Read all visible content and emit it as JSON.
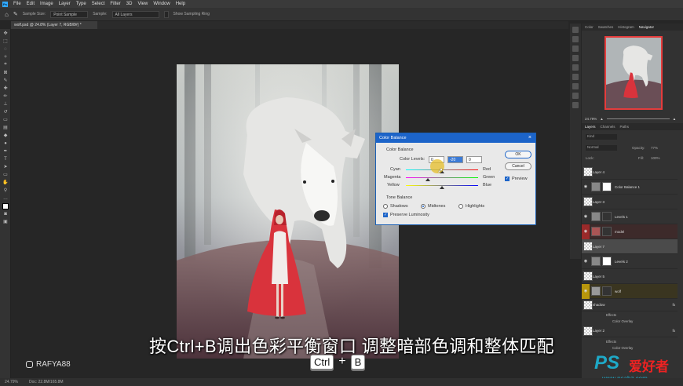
{
  "menu": [
    "File",
    "Edit",
    "Image",
    "Layer",
    "Type",
    "Select",
    "Filter",
    "3D",
    "View",
    "Window",
    "Help"
  ],
  "options": {
    "sample_size_label": "Sample Size:",
    "sample_size_value": "Point Sample",
    "sample_label": "Sample:",
    "sample_value": "All Layers",
    "show_ring": "Show Sampling Ring"
  },
  "document_tab": "wolf.psd @ 24.8% (Layer 7, RGB/8#) *",
  "status": {
    "zoom": "24.79%",
    "doc": "Doc: 22.8M/165.8M"
  },
  "panel_tabs": [
    "Color",
    "Swatches",
    "Histogram",
    "Navigator"
  ],
  "navigator_zoom": "24.79%",
  "layers_tabs": [
    "Layers",
    "Channels",
    "Paths"
  ],
  "layer_options": {
    "kind": "Kind",
    "blend": "Normal",
    "opacity_label": "Opacity:",
    "opacity": "77%",
    "lock_label": "Lock:",
    "fill_label": "Fill:",
    "fill": "100%"
  },
  "layers": [
    {
      "name": "Layer 4"
    },
    {
      "name": "Color Balance 1"
    },
    {
      "name": "Layer 3"
    },
    {
      "name": "Levels 1"
    },
    {
      "name": "model"
    },
    {
      "name": "Layer 7"
    },
    {
      "name": "Levels 2"
    },
    {
      "name": "Layer 5"
    },
    {
      "name": "wolf"
    },
    {
      "name": "shadow"
    },
    {
      "name": "Layer 2"
    }
  ],
  "layer_effects": {
    "effects": "Effects",
    "color_overlay": "Color Overlay"
  },
  "dialog": {
    "title": "Color Balance",
    "section1": "Color Balance",
    "color_levels_label": "Color Levels:",
    "level1": "0",
    "level2": "-20",
    "level3": "0",
    "cyan": "Cyan",
    "red": "Red",
    "magenta": "Magenta",
    "green": "Green",
    "yellow": "Yellow",
    "blue": "Blue",
    "section2": "Tone Balance",
    "shadows": "Shadows",
    "midtones": "Midtones",
    "highlights": "Highlights",
    "preserve": "Preserve Luminosity",
    "ok": "OK",
    "cancel": "Cancel",
    "preview": "Preview"
  },
  "subtitle": "按Ctrl+B调出色彩平衡窗口 调整暗部色调和整体匹配",
  "keys": {
    "k1": "Ctrl",
    "plus": "+",
    "k2": "B"
  },
  "watermark": "RAFYA88",
  "logo": {
    "text": "PS",
    "cn": "爱好者",
    "url": "www.psahz.com"
  }
}
